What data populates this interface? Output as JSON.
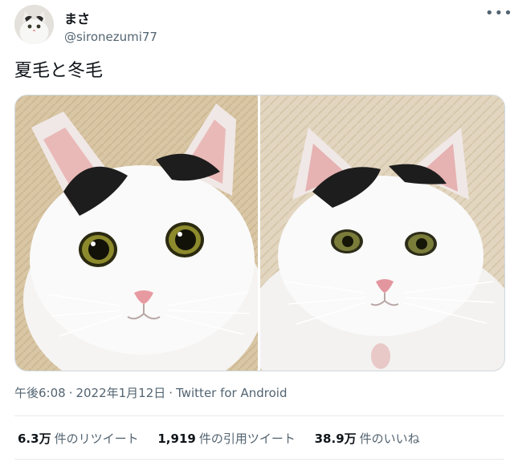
{
  "header": {
    "display_name": "まさ",
    "handle": "@sironezumi77",
    "more_icon": "more-horizontal-icon"
  },
  "tweet": {
    "text": "夏毛と冬毛"
  },
  "media": {
    "photos": [
      {
        "subject": "cat-summer-coat-photo"
      },
      {
        "subject": "cat-winter-coat-photo"
      }
    ]
  },
  "meta": {
    "time": "午後6:08",
    "separator": "·",
    "date": "2022年1月12日",
    "source": "Twitter for Android"
  },
  "stats": {
    "retweets": {
      "count": "6.3万",
      "label": "件のリツイート"
    },
    "quotes": {
      "count": "1,919",
      "label": "件の引用ツイート"
    },
    "likes": {
      "count": "38.9万",
      "label": "件のいいね"
    }
  },
  "colors": {
    "text": "#0f1419",
    "secondary": "#536471",
    "border": "#e7e9ea"
  }
}
